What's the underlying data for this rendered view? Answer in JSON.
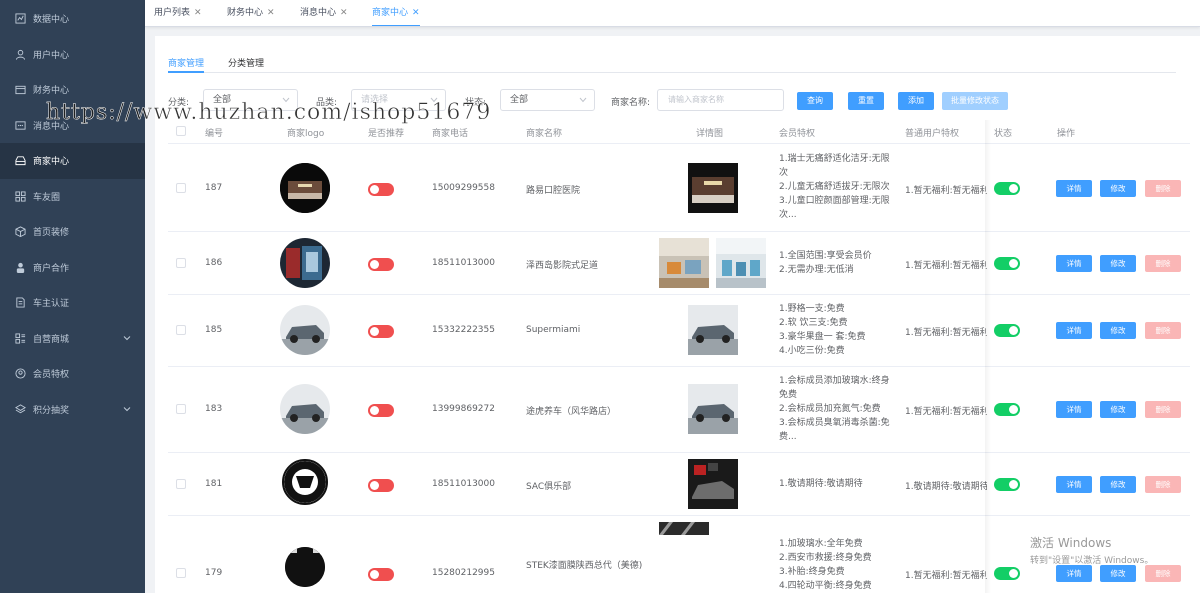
{
  "sidebar": {
    "items": [
      {
        "label": "数据中心",
        "icon": "chart-icon"
      },
      {
        "label": "用户中心",
        "icon": "user-icon"
      },
      {
        "label": "财务中心",
        "icon": "wallet-icon"
      },
      {
        "label": "消息中心",
        "icon": "message-icon"
      },
      {
        "label": "商家中心",
        "icon": "store-icon",
        "active": true
      },
      {
        "label": "车友圈",
        "icon": "grid-icon"
      },
      {
        "label": "首页装修",
        "icon": "box-icon"
      },
      {
        "label": "商户合作",
        "icon": "person-icon"
      },
      {
        "label": "车主认证",
        "icon": "document-icon"
      },
      {
        "label": "自营商城",
        "icon": "apps-icon",
        "expandable": true
      },
      {
        "label": "会员特权",
        "icon": "vip-icon"
      },
      {
        "label": "积分抽奖",
        "icon": "layers-icon",
        "expandable": true
      }
    ]
  },
  "tabs": [
    {
      "label": "用户列表"
    },
    {
      "label": "财务中心"
    },
    {
      "label": "消息中心"
    },
    {
      "label": "商家中心",
      "active": true
    }
  ],
  "subtabs": [
    "商家管理",
    "分类管理"
  ],
  "filters": {
    "category_label": "分类:",
    "category_value": "全部",
    "type_label": "品类:",
    "type_placeholder": "请选择",
    "status_label": "状态:",
    "status_value": "全部",
    "name_label": "商家名称:",
    "name_placeholder": "请输入商家名称"
  },
  "buttons": {
    "query": "查询",
    "reset": "重置",
    "add": "添加",
    "batch": "批量修改状态"
  },
  "table": {
    "headers": [
      "编号",
      "商家logo",
      "是否推荐",
      "商家电话",
      "商家名称",
      "详情图",
      "会员特权",
      "普通用户特权",
      "状态",
      "操作"
    ],
    "action_labels": {
      "detail": "详情",
      "edit": "修改",
      "delete": "删除"
    },
    "rows": [
      {
        "id": "187",
        "phone": "15009299558",
        "name": "路易口腔医院",
        "perks": [
          "1.瑞士无痛舒适化洁牙:无限次",
          "2.儿童无痛舒适拔牙:无限次",
          "3.儿童口腔颜面部管理:无限次..."
        ],
        "normal": "1.暂无福利:暂无福利",
        "recommend": false,
        "status": true
      },
      {
        "id": "186",
        "phone": "18511013000",
        "name": "泽西岛影院式足道",
        "perks": [
          "1.全国范围:享受会员价",
          "2.无需办理:无低消"
        ],
        "normal": "1.暂无福利:暂无福利",
        "recommend": false,
        "status": true
      },
      {
        "id": "185",
        "phone": "15332222355",
        "name": "Supermiami",
        "perks": [
          "1.野格一支:免费",
          "2.软 饮三支:免费",
          "3.豪华果盘一 套:免费",
          "4.小吃三份:免费"
        ],
        "normal": "1.暂无福利:暂无福利",
        "recommend": false,
        "status": true
      },
      {
        "id": "183",
        "phone": "13999869272",
        "name": "途虎养车（风华路店）",
        "perks": [
          "1.会标成员添加玻璃水:终身免费",
          "2.会标成员加充氮气:免费",
          "3.会标成员臭氧消毒杀菌:免费..."
        ],
        "normal": "1.暂无福利:暂无福利",
        "recommend": false,
        "status": true
      },
      {
        "id": "181",
        "phone": "18511013000",
        "name": "SAC俱乐部",
        "perks": [
          "1.敬请期待:敬请期待"
        ],
        "normal": "1.敬请期待:敬请期待",
        "recommend": false,
        "status": true
      },
      {
        "id": "179",
        "phone": "15280212995",
        "name": "STEK漆面膜陕西总代（美德)",
        "perks": [
          "1.加玻璃水:全年免费",
          "2.西安市救援:终身免费",
          "3.补胎:终身免费",
          "4.四轮动平衡:终身免费"
        ],
        "normal": "1.暂无福利:暂无福利",
        "recommend": false,
        "status": true
      }
    ]
  },
  "overlay": {
    "watermark": "https://www.huzhan.com/ishop51679",
    "activation_title": "激活 Windows",
    "activation_sub": "转到\"设置\"以激活 Windows。"
  },
  "colors": {
    "sidebar": "#304156",
    "accent": "#409eff",
    "switch_on": "#13ce66",
    "switch_off": "#f04f4f"
  }
}
